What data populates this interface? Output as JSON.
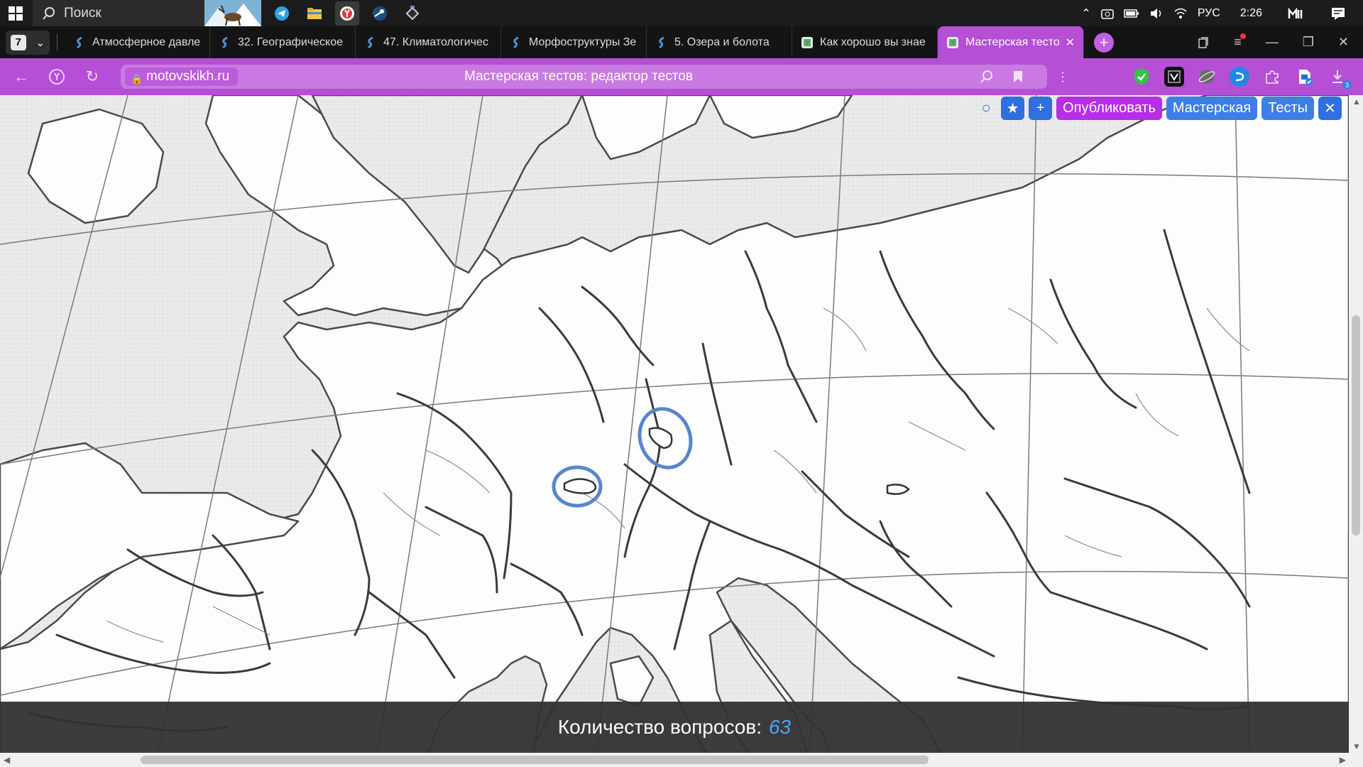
{
  "taskbar": {
    "search_placeholder": "Поиск",
    "apps": [
      "telegram-icon",
      "folder-icon",
      "yandex-browser-icon",
      "steam-icon",
      "app-icon"
    ],
    "lang": "РУС",
    "time": "2:26"
  },
  "tabs": {
    "count": "7",
    "items": [
      {
        "label": "Атмосферное давле"
      },
      {
        "label": "32. Географическое"
      },
      {
        "label": "47. Климатологичес"
      },
      {
        "label": "Морфоструктуры Зе"
      },
      {
        "label": "5. Озера и болота"
      },
      {
        "label": "Как хорошо вы знае"
      },
      {
        "label": "Мастерская тесто"
      }
    ],
    "active_index": 6
  },
  "address": {
    "domain": "motovskikh.ru",
    "title": "Мастерская тестов: редактор тестов"
  },
  "toolbar": {
    "publish": "Опубликовать",
    "workshop": "Мастерская",
    "tests": "Тесты"
  },
  "footer": {
    "label": "Количество вопросов:",
    "value": "63"
  },
  "colors": {
    "accent": "#b44fd6",
    "publish": "#b82ee6",
    "button_blue": "#3d7fe6",
    "highlight_circle": "#5a86c9"
  }
}
